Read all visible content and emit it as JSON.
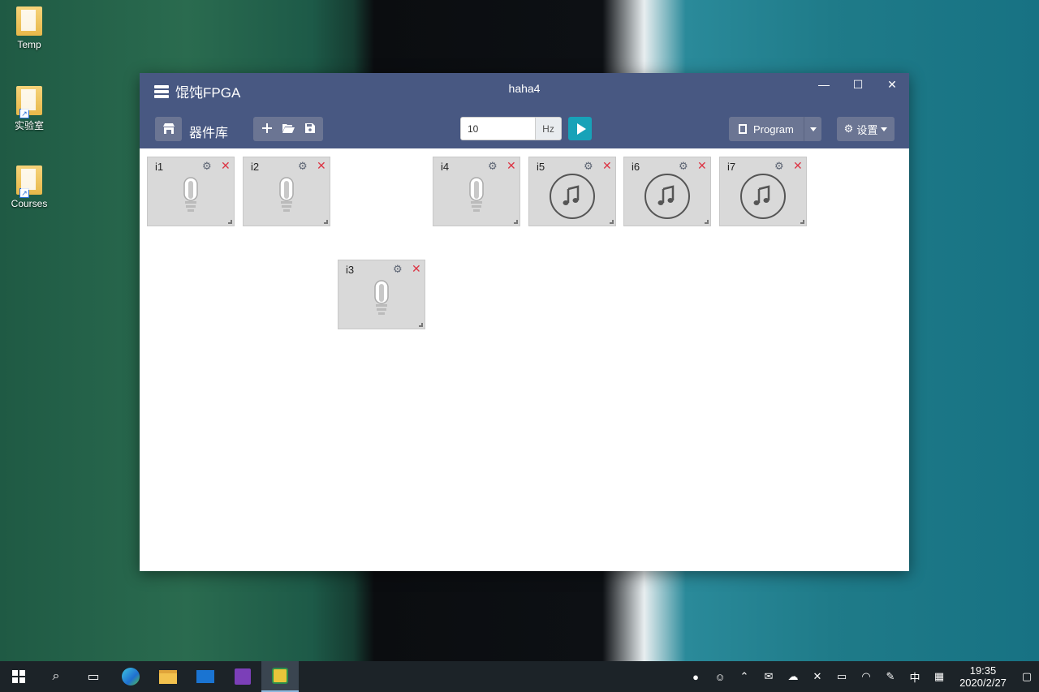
{
  "desktop": {
    "icons": [
      {
        "label": "Temp"
      },
      {
        "label": "实验室"
      },
      {
        "label": "Courses"
      }
    ]
  },
  "window": {
    "app_title": "馄饨FPGA",
    "doc_title": "haha4",
    "controls": {
      "minimize": "—",
      "maximize": "☐",
      "close": "✕"
    }
  },
  "toolbar": {
    "library_label": "器件库",
    "frequency_value": "10",
    "frequency_unit": "Hz",
    "program_label": "Program",
    "settings_label": "设置"
  },
  "components": [
    {
      "id": "i1",
      "type": "bulb"
    },
    {
      "id": "i2",
      "type": "bulb"
    },
    {
      "id": "i3",
      "type": "bulb"
    },
    {
      "id": "i4",
      "type": "bulb"
    },
    {
      "id": "i5",
      "type": "buzzer"
    },
    {
      "id": "i6",
      "type": "buzzer"
    },
    {
      "id": "i7",
      "type": "buzzer"
    }
  ],
  "taskbar": {
    "ime": "中",
    "time": "19:35",
    "date": "2020/2/27"
  }
}
